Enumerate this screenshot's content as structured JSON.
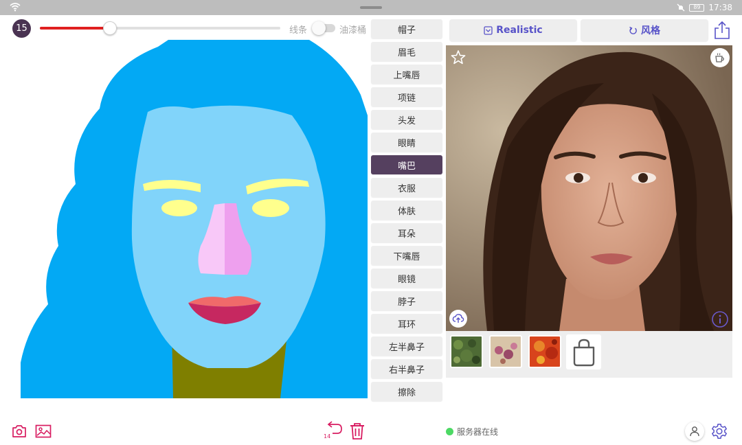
{
  "status_bar": {
    "time": "17:38",
    "battery": "89",
    "icons": [
      "wifi-icon",
      "mute-icon",
      "battery-icon"
    ]
  },
  "brush": {
    "size": "15",
    "slider_level": 0.29,
    "accent_color": "#e02020"
  },
  "fill_mode": {
    "left_label": "线条",
    "right_label": "油漆桶",
    "bucket_enabled": false
  },
  "labels": [
    {
      "text": "帽子"
    },
    {
      "text": "眉毛"
    },
    {
      "text": "上嘴唇"
    },
    {
      "text": "项链"
    },
    {
      "text": "头发"
    },
    {
      "text": "眼睛"
    },
    {
      "text": "嘴巴",
      "active": true
    },
    {
      "text": "衣服"
    },
    {
      "text": "体肤"
    },
    {
      "text": "耳朵"
    },
    {
      "text": "下嘴唇"
    },
    {
      "text": "眼镜"
    },
    {
      "text": "脖子"
    },
    {
      "text": "耳环"
    },
    {
      "text": "左半鼻子"
    },
    {
      "text": "右半鼻子"
    },
    {
      "text": "擦除"
    }
  ],
  "right_panel": {
    "realistic_label": "Realistic",
    "style_label": "风格",
    "accent_color": "#5752c8"
  },
  "style_thumbnails": [
    {
      "name": "green-foliage-style"
    },
    {
      "name": "pink-floral-style"
    },
    {
      "name": "red-leaves-style"
    }
  ],
  "bottom": {
    "undo_count": "14",
    "server_status": "服务器在线",
    "status_color": "#4cd964",
    "icon_color": "#d81b60"
  }
}
